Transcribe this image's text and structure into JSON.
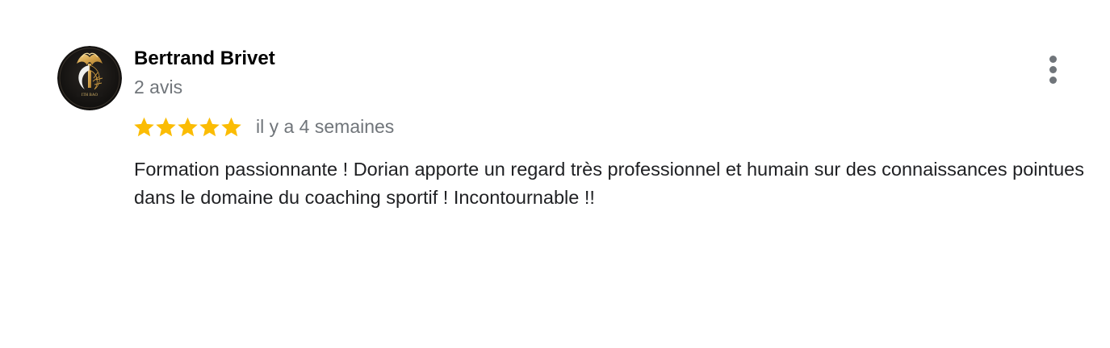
{
  "review": {
    "author": {
      "name": "Bertrand Brivet",
      "review_count": "2 avis",
      "avatar_icon": "gold-tree-logo-icon",
      "avatar_text": "ITH BAO"
    },
    "rating": {
      "stars": 5,
      "max_stars": 5,
      "star_color": "#fbbc04",
      "relative_date": "il y a 4 semaines"
    },
    "text": "Formation passionnante ! Dorian apporte un regard très professionnel et humain sur des connaissances pointues dans le domaine du coaching sportif ! Incontournable !!",
    "more_options_icon": "more-vertical-icon"
  },
  "colors": {
    "name": "#000000",
    "secondary_text": "#70757a",
    "body_text": "#202124",
    "star": "#fbbc04"
  }
}
